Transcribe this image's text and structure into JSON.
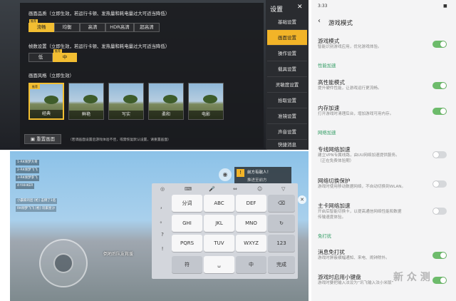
{
  "game_settings": {
    "quality_label": "画面品质（立即生效，若运行卡顿、发热量和耗电量过大可适当降低）",
    "quality_tag": "推荐",
    "quality_options": [
      "流畅",
      "均衡",
      "高清",
      "HDR高清",
      "超高清"
    ],
    "fps_label": "帧数设置（立即生效，若运行卡顿、发热量和耗电量过大可适当降低）",
    "fps_tag": "推荐",
    "fps_options": [
      "低",
      "中"
    ],
    "style_label": "画面风格（立即生效）",
    "style_tag": "推荐",
    "styles": [
      "经典",
      "鲜艳",
      "写实",
      "柔和",
      "电影"
    ],
    "reset_button": "重置画面",
    "footer_note": "（若调画面设置后游戏体验不佳，或需恢复默认设置，请重置画面）",
    "side_title": "设置",
    "side_items": [
      "基础设置",
      "画面设置",
      "操作设置",
      "载具设置",
      "灵敏度设置",
      "拾取设置",
      "准镜设置",
      "声音设置",
      "快捷消息"
    ]
  },
  "game_screen": {
    "teammates": [
      "1-RK倾梦大哥",
      "2-RK倾梦飞飞",
      "3-RK倾梦李飞",
      "4-YHHKER"
    ],
    "kill_feed": [
      "小霸家的团 [枪] 击倒了1名",
      "RK倾梦飞飞 [枪] 玩家星沙"
    ],
    "pickup_prompt": "前方有敌人！",
    "pickup_sub": "推进至前方",
    "chat_text": "倒地后队友救援",
    "keyboard_tools": [
      "◎",
      "⌨",
      "🎤",
      "⇔",
      "☺",
      "▽"
    ],
    "keys_row1": [
      "分词",
      "ABC",
      "DEF",
      "⌫"
    ],
    "keys_row2": [
      "GHI",
      "JKL",
      "MNO",
      "↻"
    ],
    "keys_row3": [
      "PQRS",
      "TUV",
      "WXYZ",
      "123"
    ],
    "keys_row4": [
      "符",
      "␣",
      "中",
      "完成"
    ],
    "punct": [
      "，",
      "。",
      "?",
      "!"
    ]
  },
  "phone": {
    "time": "3:33",
    "battery": "■",
    "page_title": "游戏模式",
    "items": [
      {
        "title": "游戏模式",
        "desc": "智能识别游戏应用，优化游戏体验。",
        "on": true
      },
      {
        "section": "性能加速"
      },
      {
        "title": "高性能模式",
        "desc": "提升硬件性能，让游戏运行更流畅。",
        "on": true
      },
      {
        "title": "内存加速",
        "desc": "打开游戏时清理后台，增加游戏可用内存。",
        "on": true
      },
      {
        "section": "网络加速"
      },
      {
        "title": "专线网络加速",
        "desc": "建立VPN专属线路，由UU网络加速提供服务。",
        "desc2": "（正在免费体验期）",
        "on": false
      },
      {
        "title": "网络切换保护",
        "desc": "游戏时使用移动数据网络，不自动切换到WLAN。",
        "on": false
      },
      {
        "title": "主卡网络加速",
        "desc": "开启后智能切换卡，以提高通信网络性能和数据",
        "desc2": "传输速度体验。",
        "on": false
      },
      {
        "section": "免打扰"
      },
      {
        "title": "消息免打扰",
        "desc": "游戏时屏蔽横幅通知、来电、闹钟除外。",
        "on": true
      },
      {
        "title": "游戏时启用小键盘",
        "desc": "游戏时要把输入法设为“讯飞输入法小米版”",
        "on": true
      }
    ],
    "watermark": "新 众 测"
  }
}
